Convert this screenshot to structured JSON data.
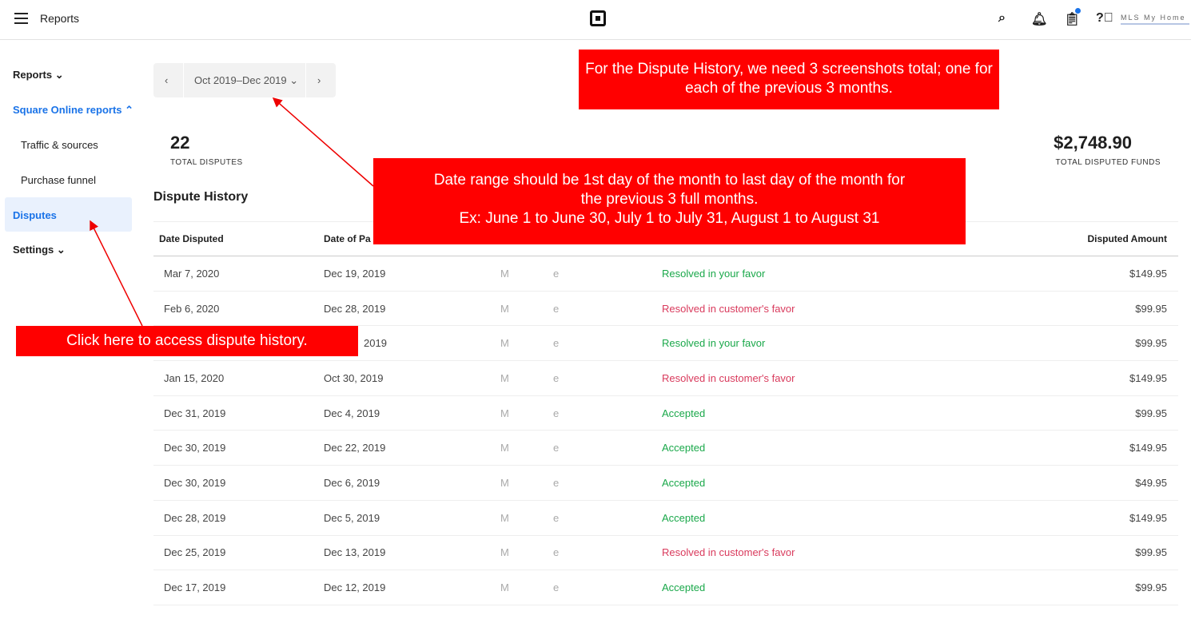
{
  "header": {
    "title": "Reports",
    "user": "MLS My Home"
  },
  "sidebar": {
    "items": [
      {
        "label": "Reports ⌄"
      },
      {
        "label": "Square Online reports ⌃"
      },
      {
        "label": "Traffic & sources"
      },
      {
        "label": "Purchase funnel"
      },
      {
        "label": "Disputes"
      },
      {
        "label": "Settings ⌄"
      }
    ]
  },
  "date_range": {
    "label": "Oct 2019–Dec 2019"
  },
  "stats": {
    "disputes_value": "22",
    "disputes_label": "TOTAL DISPUTES",
    "funds_value": "$2,748.90",
    "funds_label": "TOTAL DISPUTED FUNDS"
  },
  "section_title": "Dispute History",
  "table": {
    "headers": [
      "Date Disputed",
      "Date of Pa",
      "",
      "",
      "Disputed Amount"
    ],
    "rows": [
      [
        "Mar 7, 2020",
        "Dec 19, 2019",
        "M",
        "e",
        "Resolved in your favor",
        "$149.95"
      ],
      [
        "Feb 6, 2020",
        "Dec 28, 2019",
        "M",
        "e",
        "Resolved in customer's favor",
        "$99.95"
      ],
      [
        "",
        "2019",
        "M",
        "e",
        "Resolved in your favor",
        "$99.95"
      ],
      [
        "Jan 15, 2020",
        "Oct 30, 2019",
        "M",
        "e",
        "Resolved in customer's favor",
        "$149.95"
      ],
      [
        "Dec 31, 2019",
        "Dec 4, 2019",
        "M",
        "e",
        "Accepted",
        "$99.95"
      ],
      [
        "Dec 30, 2019",
        "Dec 22, 2019",
        "M",
        "e",
        "Accepted",
        "$149.95"
      ],
      [
        "Dec 30, 2019",
        "Dec 6, 2019",
        "M",
        "e",
        "Accepted",
        "$49.95"
      ],
      [
        "Dec 28, 2019",
        "Dec 5, 2019",
        "M",
        "e",
        "Accepted",
        "$149.95"
      ],
      [
        "Dec 25, 2019",
        "Dec 13, 2019",
        "M",
        "e",
        "Resolved in customer's favor",
        "$99.95"
      ],
      [
        "Dec 17, 2019",
        "Dec 12, 2019",
        "M",
        "e",
        "Accepted",
        "$99.95"
      ]
    ]
  },
  "annotations": {
    "top": "For the Dispute History, we need 3 screenshots total; one for each of the previous 3 months.",
    "middle_1": "Date range should be 1st day of the month to last day of the month for the previous 3 full months.",
    "middle_2": "Ex: June 1 to June 30, July 1 to July 31, August 1 to August 31",
    "left": "Click here to access dispute history."
  },
  "colors": {
    "accent": "#1a73e8",
    "success": "#1aa84a",
    "danger": "#d93a5c",
    "annotation": "#ff0000"
  }
}
